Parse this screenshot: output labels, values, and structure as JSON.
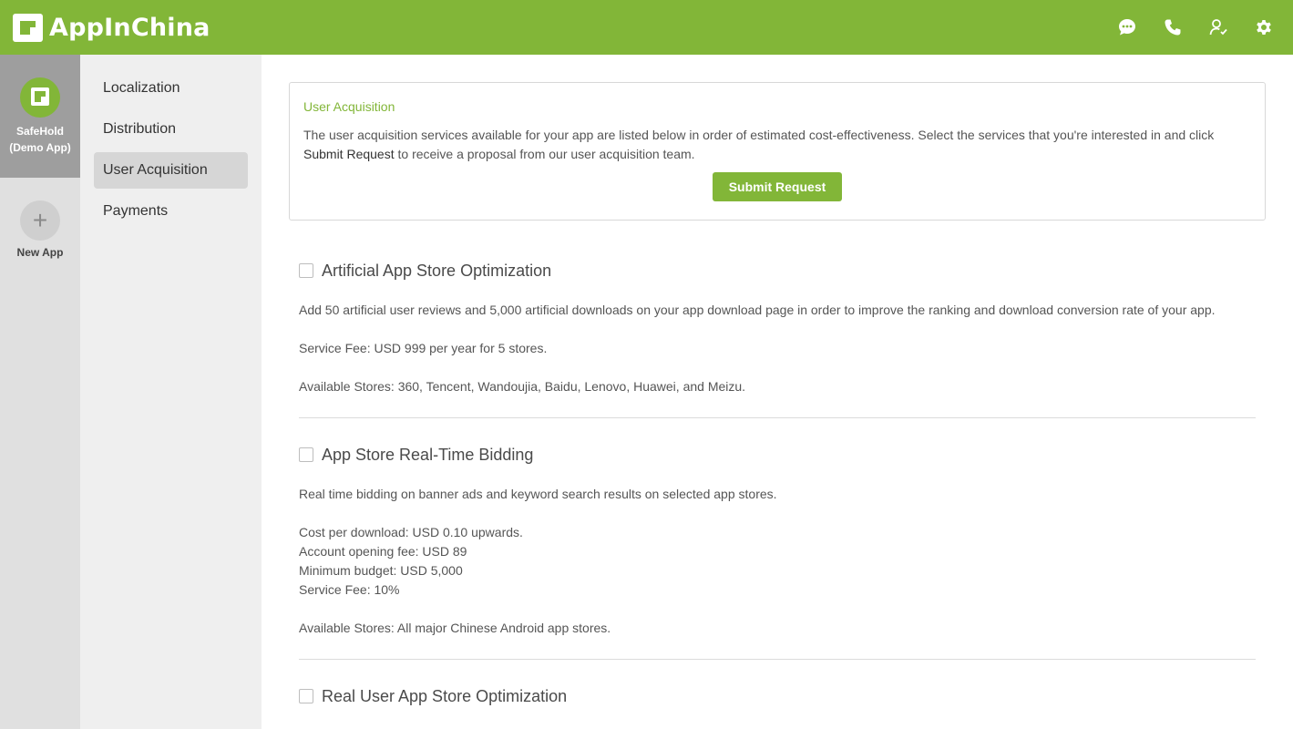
{
  "header": {
    "brand_name": "AppInChina",
    "icons": [
      "chat-icon",
      "phone-icon",
      "account-manager-icon",
      "settings-icon"
    ]
  },
  "rail": {
    "app_name_line1": "SafeHold",
    "app_name_line2": "(Demo App)",
    "app_icon_text": "AppInChina",
    "new_app_label": "New App",
    "new_app_symbol": "+"
  },
  "nav": {
    "items": [
      {
        "label": "Localization"
      },
      {
        "label": "Distribution"
      },
      {
        "label": "User Acquisition"
      },
      {
        "label": "Payments"
      }
    ],
    "active": "User Acquisition"
  },
  "intro": {
    "title": "User Acquisition",
    "text_before": "The user acquisition services available for your app are listed below in order of estimated cost-effectiveness. Select the services that you're interested in and click",
    "text_emph": "Submit Request",
    "text_after": "to receive a proposal from our user acquisition team.",
    "button_label": "Submit Request"
  },
  "services": [
    {
      "title": "Artificial App Store Optimization",
      "description": "Add 50 artificial user reviews and 5,000 artificial downloads on your app download page in order to improve the ranking and download conversion rate of your app.",
      "fee": "Service Fee: USD 999 per year for 5 stores.",
      "stores": "Available Stores: 360, Tencent, Wandoujia, Baidu, Lenovo, Huawei, and Meizu."
    },
    {
      "title": "App Store Real-Time Bidding",
      "description": "Real time bidding on banner ads and keyword search results on selected app stores.",
      "cost_lines": [
        "Cost per download: USD 0.10 upwards.",
        "Account opening fee: USD 89",
        "Minimum budget: USD 5,000",
        "Service Fee: 10%"
      ],
      "stores": "Available Stores: All major Chinese Android app stores."
    },
    {
      "title": "Real User App Store Optimization"
    }
  ],
  "colors": {
    "brand_green": "#82b638",
    "rail_bg": "#e0e0e0",
    "rail_active_bg": "#9e9e9e",
    "nav_bg": "#efefef",
    "nav_active_bg": "#d6d6d6"
  }
}
